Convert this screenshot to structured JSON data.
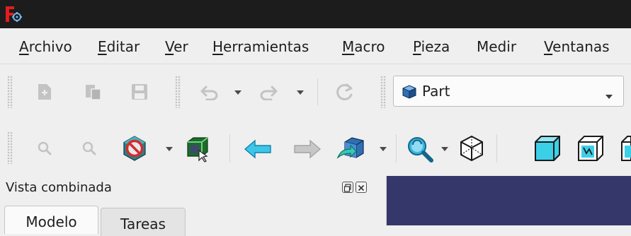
{
  "window": {
    "logo_icon": "freecad-logo-icon",
    "title_bar_color": "#1c1c1c"
  },
  "menubar": {
    "items": [
      {
        "mnemonic": "A",
        "rest": "rchivo"
      },
      {
        "mnemonic": "E",
        "rest": "ditar"
      },
      {
        "mnemonic": "V",
        "rest": "er"
      },
      {
        "mnemonic": "H",
        "rest": "erramientas"
      },
      {
        "mnemonic": "M",
        "rest": "acro"
      },
      {
        "mnemonic": "P",
        "rest": "ieza"
      },
      {
        "mnemonic": "",
        "rest": "Medir"
      },
      {
        "mnemonic": "V",
        "rest": "entanas"
      }
    ]
  },
  "file_toolbar": {
    "icons": [
      "new-document-icon",
      "open-document-icon",
      "save-icon",
      "undo-icon",
      "undo-dropdown-icon",
      "redo-icon",
      "redo-dropdown-icon",
      "refresh-icon"
    ]
  },
  "workbench_selector": {
    "selected": "Part",
    "icon": "part-cube-icon"
  },
  "view_toolbar": {
    "icons": [
      "zoom-icon",
      "zoom-icon",
      "draw-style-icon",
      "draw-style-dropdown-icon",
      "bounding-box-icon",
      "back-arrow-icon",
      "forward-arrow-icon",
      "std-views-icon",
      "std-views-dropdown-icon",
      "fit-all-zoom-icon",
      "zoom-dropdown-icon",
      "isometric-view-icon",
      "front-view-icon",
      "top-view-icon"
    ]
  },
  "combo_view": {
    "title": "Vista combinada",
    "tabs": [
      {
        "label": "Modelo"
      },
      {
        "label": "Tareas"
      }
    ]
  },
  "colors": {
    "viewport_background": "#35376a",
    "accent_blue": "#2b8fd6",
    "stop_red": "#d32d2d"
  }
}
